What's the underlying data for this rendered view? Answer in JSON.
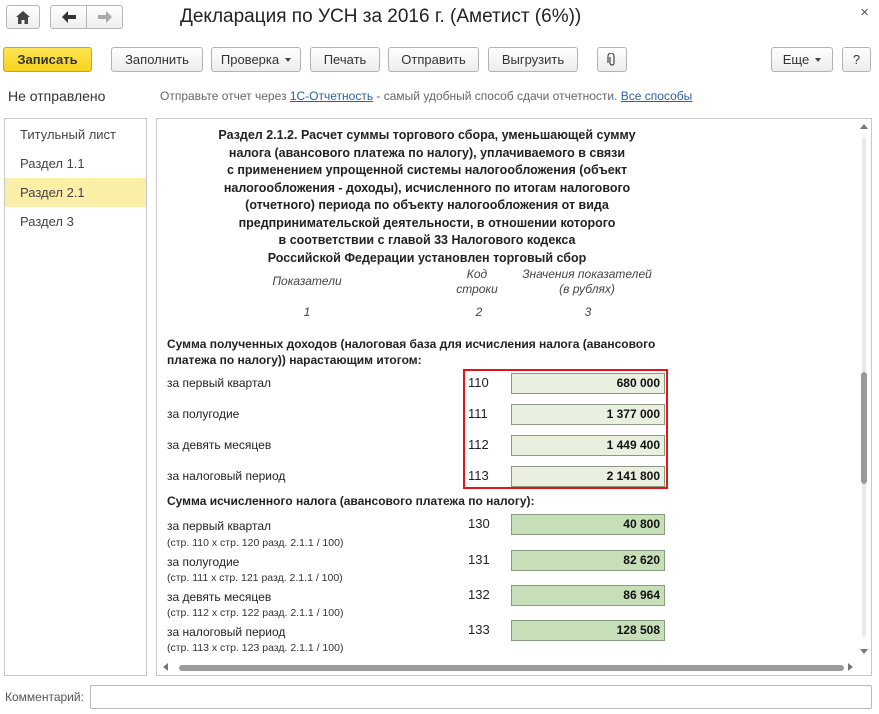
{
  "window": {
    "title": "Декларация по УСН за 2016 г. (Аметист (6%))",
    "close_glyph": "×"
  },
  "toolbar": {
    "save": "Записать",
    "fill": "Заполнить",
    "check": "Проверка",
    "print": "Печать",
    "send": "Отправить",
    "export": "Выгрузить",
    "more": "Еще",
    "help": "?"
  },
  "status": {
    "state": "Не отправлено",
    "hint_prefix": "Отправьте отчет через ",
    "hint_link": "1С-Отчетность",
    "hint_middle": " - самый удобный способ сдачи отчетности. ",
    "hint_link2": "Все способы"
  },
  "sidebar": {
    "items": [
      {
        "label": "Титульный лист"
      },
      {
        "label": "Раздел 1.1"
      },
      {
        "label": "Раздел 2.1"
      },
      {
        "label": "Раздел 3"
      }
    ]
  },
  "section": {
    "title_lines": [
      "Раздел 2.1.2. Расчет суммы торгового сбора, уменьшающей сумму",
      "налога (авансового платежа по налогу), уплачиваемого в связи",
      "с применением упрощенной системы налогообложения (объект",
      "налогообложения - доходы), исчисленного по итогам налогового",
      "(отчетного) периода по объекту налогообложения от вида",
      "предпринимательской деятельности, в отношении которого",
      "в соответствии с главой 33 Налогового кодекса",
      "Российской Федерации установлен торговый сбор"
    ],
    "headers": {
      "indicators": "Показатели",
      "code_line1": "Код",
      "code_line2": "строки",
      "values_line1": "Значения показателей",
      "values_line2": "(в рублях)",
      "num1": "1",
      "num2": "2",
      "num3": "3"
    },
    "group1": {
      "label": "Сумма полученных доходов (налоговая база для исчисления налога (авансового платежа по налогу)) нарастающим итогом:",
      "rows": [
        {
          "label": "за первый квартал",
          "code": "110",
          "value": "680 000"
        },
        {
          "label": "за полугодие",
          "code": "111",
          "value": "1 377 000"
        },
        {
          "label": "за девять месяцев",
          "code": "112",
          "value": "1 449 400"
        },
        {
          "label": "за налоговый период",
          "code": "113",
          "value": "2 141 800"
        }
      ]
    },
    "group2": {
      "label": "Сумма исчисленного налога (авансового платежа по налогу):",
      "rows": [
        {
          "label": "за первый квартал",
          "sub": "(стр. 110 х стр. 120 разд. 2.1.1 / 100)",
          "code": "130",
          "value": "40 800"
        },
        {
          "label": "за полугодие",
          "sub": "(стр. 111 х стр. 121 разд. 2.1.1 / 100)",
          "code": "131",
          "value": "82 620"
        },
        {
          "label": "за девять месяцев",
          "sub": "(стр. 112 х стр. 122 разд. 2.1.1 / 100)",
          "code": "132",
          "value": "86 964"
        },
        {
          "label": "за налоговый период",
          "sub": "(стр. 113 х стр. 123 разд. 2.1.1 / 100)",
          "code": "133",
          "value": "128 508"
        }
      ]
    }
  },
  "comment": {
    "label": "Комментарий:",
    "value": ""
  },
  "colors": {
    "primary_button": "#f7d31c",
    "active_nav": "#fbeea7",
    "highlight_border": "#e2151c",
    "value_light": "#e9f0df",
    "value_dark": "#c6dfb8",
    "link": "#2a5fa0"
  }
}
